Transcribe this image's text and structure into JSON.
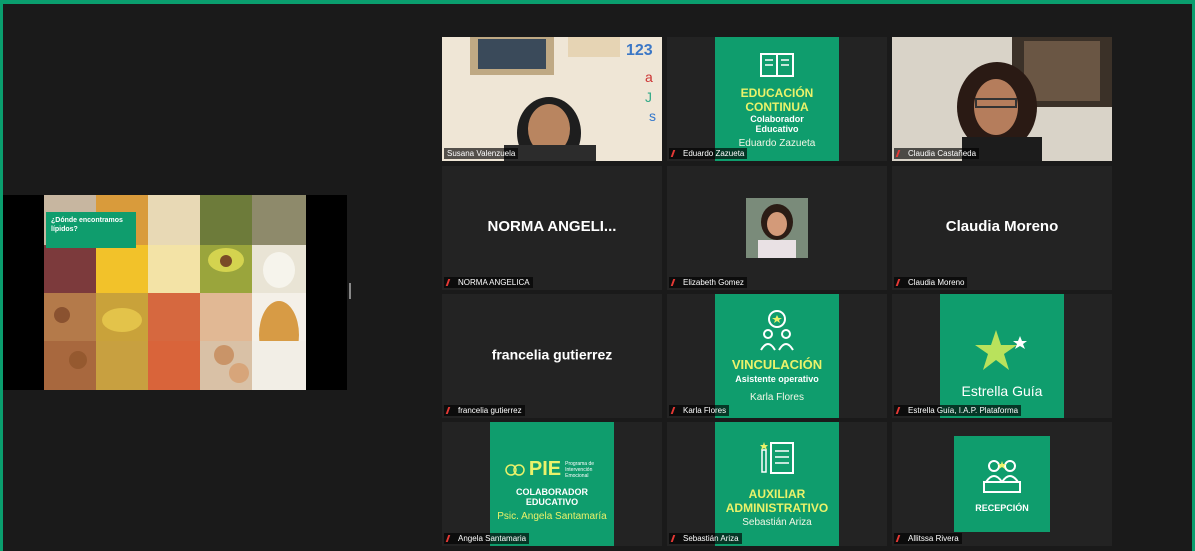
{
  "slide": {
    "title": "¿Dónde encontramos lípidos?"
  },
  "tiles": [
    {
      "name": "Susana Valenzuela",
      "kind": "camera"
    },
    {
      "name": "Eduardo Zazueta",
      "kind": "poster",
      "poster": {
        "line1": "EDUCACIÓN",
        "line2": "CONTINUA",
        "line3": "Colaborador",
        "line4": "Educativo",
        "line5": "Eduardo Zazueta"
      }
    },
    {
      "name": "Claudia Castañeda",
      "kind": "camera"
    },
    {
      "name": "NORMA ANGELICA",
      "kind": "text",
      "display": "NORMA  ANGELI..."
    },
    {
      "name": "Elizabeth Gomez",
      "kind": "photo"
    },
    {
      "name": "Claudia Moreno",
      "kind": "text",
      "display": "Claudia Moreno"
    },
    {
      "name": "francelia gutierrez",
      "kind": "text",
      "display": "francelia gutierrez"
    },
    {
      "name": "Karla Flores",
      "kind": "poster",
      "poster": {
        "line1": "VINCULACIÓN",
        "line2": "Asistente operativo",
        "line3": "Karla Flores"
      }
    },
    {
      "name": "Estrella Guía, I.A.P. Plataforma",
      "kind": "poster",
      "poster": {
        "line1": "Estrella Guía"
      }
    },
    {
      "name": "Angela Santamaria",
      "kind": "poster",
      "poster": {
        "line1": "PIE",
        "line2": "Programa de Intervención Emocional",
        "line3": "COLABORADOR",
        "line4": "EDUCATIVO",
        "line5": "Psic. Angela Santamaría"
      }
    },
    {
      "name": "Sebastián Ariza",
      "kind": "poster",
      "poster": {
        "line1": "AUXILIAR",
        "line2": "ADMINISTRATIVO",
        "line3": "Sebastián Ariza"
      }
    },
    {
      "name": "Allitssa Rivera",
      "kind": "poster",
      "poster": {
        "line1": "RECEPCIÓN"
      }
    }
  ],
  "colors": {
    "brand": "#0f9d6d",
    "active_border": "#d6e15c",
    "mic_muted": "#e53935"
  }
}
